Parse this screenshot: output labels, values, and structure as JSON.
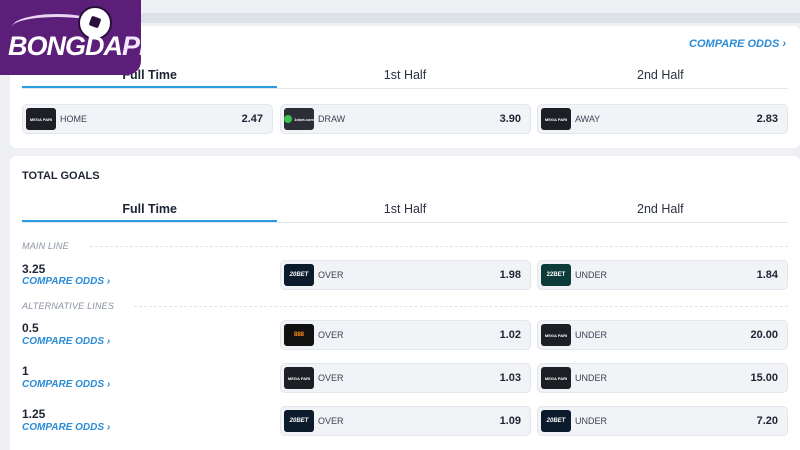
{
  "logo": {
    "text_main": "BONGDA",
    "text_accent": "PI"
  },
  "header": {
    "compare_odds": "COMPARE ODDS ›"
  },
  "match_result": {
    "tabs": [
      "Full Time",
      "1st Half",
      "2nd Half"
    ],
    "odds": [
      {
        "bookmaker": "MEGA PARI",
        "label": "HOME",
        "value": "2.47"
      },
      {
        "bookmaker": "1xbet.com",
        "label": "DRAW",
        "value": "3.90"
      },
      {
        "bookmaker": "MEGA PARI",
        "label": "AWAY",
        "value": "2.83"
      }
    ]
  },
  "total_goals": {
    "title": "TOTAL GOALS",
    "tabs": [
      "Full Time",
      "1st Half",
      "2nd Half"
    ],
    "main_line_label": "MAIN LINE",
    "alt_lines_label": "ALTERNATIVE LINES",
    "compare_label": "COMPARE ODDS ›",
    "lines": [
      {
        "line": "3.25",
        "over": {
          "bookmaker": "20BET",
          "label": "OVER",
          "value": "1.98"
        },
        "under": {
          "bookmaker": "22BET",
          "label": "UNDER",
          "value": "1.84"
        }
      },
      {
        "line": "0.5",
        "over": {
          "bookmaker": "888",
          "label": "OVER",
          "value": "1.02"
        },
        "under": {
          "bookmaker": "MEGA PARI",
          "label": "UNDER",
          "value": "20.00"
        }
      },
      {
        "line": "1",
        "over": {
          "bookmaker": "MEGA PARI",
          "label": "OVER",
          "value": "1.03"
        },
        "under": {
          "bookmaker": "MEGA PARI",
          "label": "UNDER",
          "value": "15.00"
        }
      },
      {
        "line": "1.25",
        "over": {
          "bookmaker": "20BET",
          "label": "OVER",
          "value": "1.09"
        },
        "under": {
          "bookmaker": "20BET",
          "label": "UNDER",
          "value": "7.20"
        }
      }
    ]
  }
}
